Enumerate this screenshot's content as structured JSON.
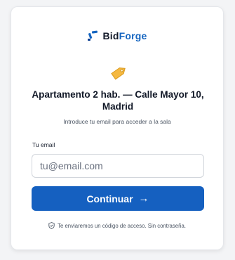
{
  "brand": {
    "name_part1": "Bid",
    "name_part2": "Forge",
    "primary_color": "#1565c0"
  },
  "listing": {
    "title": "Apartamento 2 hab. — Calle Mayor 10, Madrid",
    "subtitle": "Introduce tu email para acceder a la sala",
    "icon": "tag-icon"
  },
  "form": {
    "email_label": "Tu email",
    "email_placeholder": "tu@email.com",
    "email_value": "",
    "submit_label": "Continuar",
    "submit_icon": "→"
  },
  "footer": {
    "note": "Te enviaremos un código de acceso. Sin contraseña.",
    "icon": "shield-icon"
  }
}
